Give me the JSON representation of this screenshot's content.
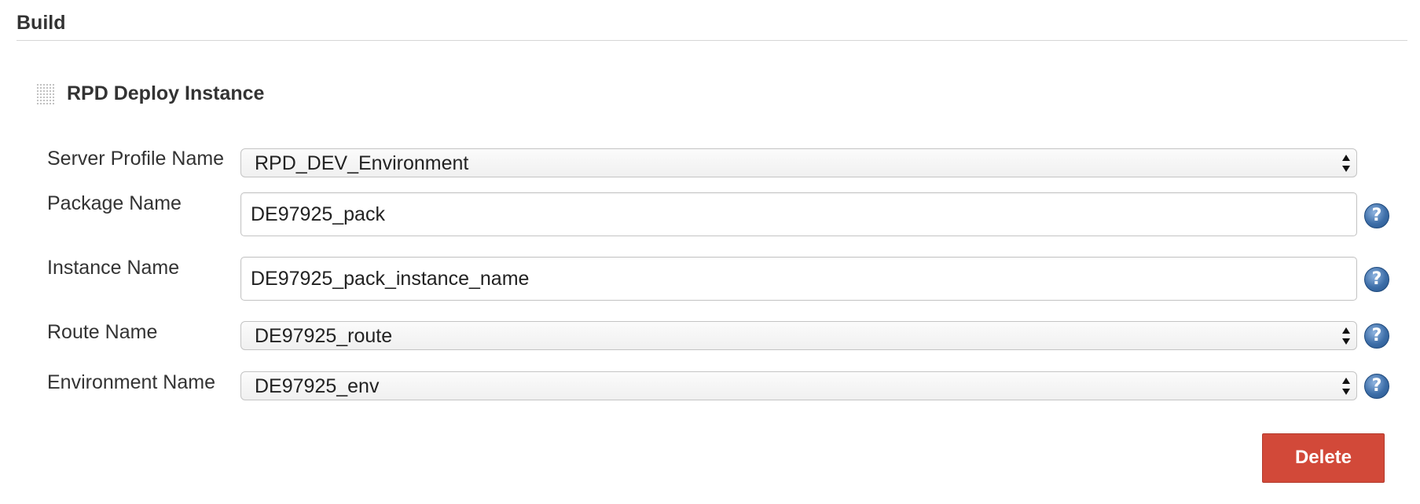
{
  "section": {
    "title": "Build"
  },
  "step": {
    "title": "RPD Deploy Instance"
  },
  "fields": {
    "server_profile": {
      "label": "Server Profile Name",
      "value": "RPD_DEV_Environment"
    },
    "package": {
      "label": "Package Name",
      "value": "DE97925_pack"
    },
    "instance": {
      "label": "Instance Name",
      "value": "DE97925_pack_instance_name"
    },
    "route": {
      "label": "Route Name",
      "value": "DE97925_route"
    },
    "environment": {
      "label": "Environment Name",
      "value": "DE97925_env"
    }
  },
  "help_icon_glyph": "?",
  "actions": {
    "delete_label": "Delete"
  },
  "colors": {
    "delete_button": "#d24939",
    "help_icon": "#3d6ea8"
  },
  "icons": {
    "drag_handle": "drag-handle-icon",
    "help": "help-icon",
    "select_arrows": "select-arrows-icon"
  }
}
